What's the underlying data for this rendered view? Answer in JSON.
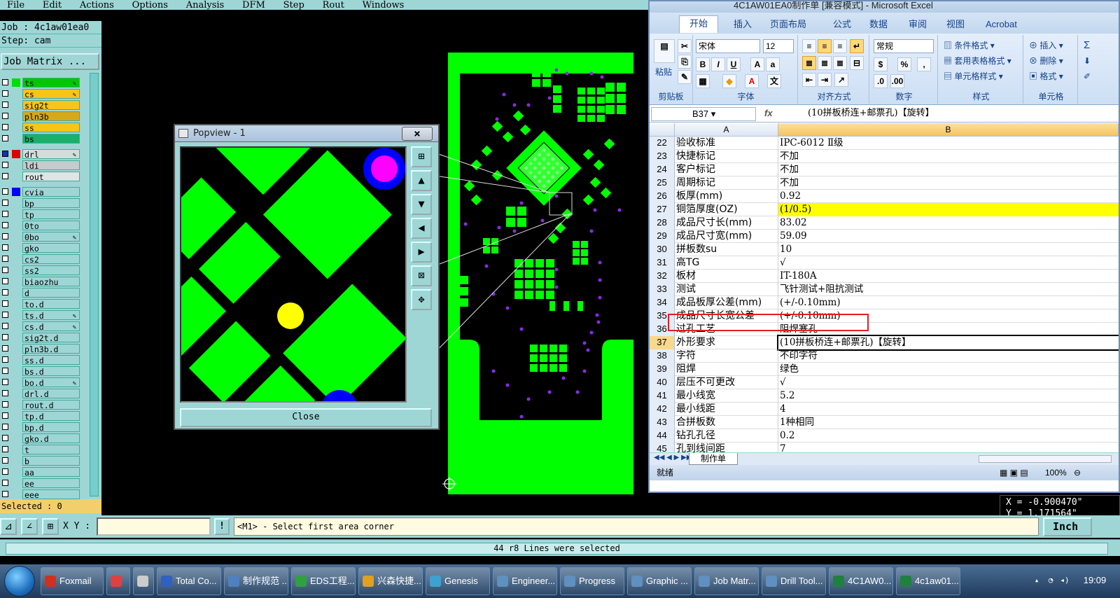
{
  "menu": [
    "File",
    "Edit",
    "Actions",
    "Options",
    "Analysis",
    "DFM",
    "Step",
    "Rout",
    "Windows"
  ],
  "job": {
    "job_label": "Job : 4c1aw01ea0",
    "step_label": "Step: cam",
    "matrix_button": "Job Matrix ..."
  },
  "layers": [
    {
      "name": "ts",
      "color": "#00c800",
      "swatch": "#00e000",
      "edit": true
    },
    {
      "name": "cs",
      "color": "#f5c518",
      "swatch": "",
      "edit": true
    },
    {
      "name": "sig2t",
      "color": "#f5c518",
      "swatch": "",
      "edit": false
    },
    {
      "name": "pln3b",
      "color": "#d7a81a",
      "swatch": "",
      "edit": false
    },
    {
      "name": "ss",
      "color": "#f5c518",
      "swatch": "",
      "edit": false
    },
    {
      "name": "bs",
      "color": "#18b06a",
      "swatch": "",
      "edit": false
    },
    {
      "gap": true
    },
    {
      "name": "drl",
      "color": "#d6dcdc",
      "swatch": "#e00000",
      "edit": true,
      "blue": true
    },
    {
      "name": "ldi",
      "color": "#c4cccc",
      "swatch": "",
      "edit": false
    },
    {
      "name": "rout",
      "color": "#dfe4e4",
      "swatch": "",
      "edit": false
    },
    {
      "gap": true
    },
    {
      "name": "cvia",
      "color": "#9ed6d6",
      "swatch": "#0000ff",
      "edit": false
    },
    {
      "name": "bp",
      "color": "#9ed6d6",
      "swatch": "",
      "edit": false
    },
    {
      "name": "tp",
      "color": "#9ed6d6",
      "swatch": "",
      "edit": false
    },
    {
      "name": "0to",
      "color": "#9ed6d6",
      "swatch": "",
      "edit": false
    },
    {
      "name": "0bo",
      "color": "#9ed6d6",
      "swatch": "",
      "edit": true
    },
    {
      "name": "gko",
      "color": "#9ed6d6",
      "swatch": "",
      "edit": false
    },
    {
      "name": "cs2",
      "color": "#9ed6d6",
      "swatch": "",
      "edit": false
    },
    {
      "name": "ss2",
      "color": "#9ed6d6",
      "swatch": "",
      "edit": false
    },
    {
      "name": "biaozhu",
      "color": "#9ed6d6",
      "swatch": "",
      "edit": false
    },
    {
      "name": "d",
      "color": "#9ed6d6",
      "swatch": "",
      "edit": false
    },
    {
      "name": "to.d",
      "color": "#9ed6d6",
      "swatch": "",
      "edit": false
    },
    {
      "name": "ts.d",
      "color": "#9ed6d6",
      "swatch": "",
      "edit": true
    },
    {
      "name": "cs.d",
      "color": "#9ed6d6",
      "swatch": "",
      "edit": true
    },
    {
      "name": "sig2t.d",
      "color": "#9ed6d6",
      "swatch": "",
      "edit": false
    },
    {
      "name": "pln3b.d",
      "color": "#9ed6d6",
      "swatch": "",
      "edit": false
    },
    {
      "name": "ss.d",
      "color": "#9ed6d6",
      "swatch": "",
      "edit": false
    },
    {
      "name": "bs.d",
      "color": "#9ed6d6",
      "swatch": "",
      "edit": false
    },
    {
      "name": "bo.d",
      "color": "#9ed6d6",
      "swatch": "",
      "edit": true
    },
    {
      "name": "drl.d",
      "color": "#9ed6d6",
      "swatch": "",
      "edit": false
    },
    {
      "name": "rout.d",
      "color": "#9ed6d6",
      "swatch": "",
      "edit": false
    },
    {
      "name": "tp.d",
      "color": "#9ed6d6",
      "swatch": "",
      "edit": false
    },
    {
      "name": "bp.d",
      "color": "#9ed6d6",
      "swatch": "",
      "edit": false
    },
    {
      "name": "gko.d",
      "color": "#9ed6d6",
      "swatch": "",
      "edit": false
    },
    {
      "name": "t",
      "color": "#9ed6d6",
      "swatch": "",
      "edit": false
    },
    {
      "name": "b",
      "color": "#9ed6d6",
      "swatch": "",
      "edit": false
    },
    {
      "name": "aa",
      "color": "#9ed6d6",
      "swatch": "",
      "edit": false
    },
    {
      "name": "ee",
      "color": "#9ed6d6",
      "swatch": "",
      "edit": false
    },
    {
      "name": "eee",
      "color": "#9ed6d6",
      "swatch": "",
      "edit": false
    }
  ],
  "selected_label": "Selected : 0",
  "status": {
    "xy_label": "X Y :",
    "xy_value": "",
    "excl": "!",
    "prompt": "<M1> - Select first area corner",
    "units": "Inch",
    "message": "44 r8 Lines were selected"
  },
  "coords": {
    "x": "X = -0.900470\"",
    "y": "Y = 1.171564\""
  },
  "popview": {
    "title": "Popview - 1",
    "close_x": "×",
    "close_button": "Close"
  },
  "excel": {
    "title": "4C1AW01EA0制作单  [兼容模式] - Microsoft Excel",
    "tabs": [
      "开始",
      "插入",
      "页面布局",
      "公式",
      "数据",
      "审阅",
      "视图",
      "Acrobat"
    ],
    "groups": {
      "clipboard": "剪贴板",
      "font": "字体",
      "align": "对齐方式",
      "number": "数字",
      "style": "样式",
      "cells": "单元格"
    },
    "buttons": {
      "paste": "粘贴",
      "cond_format": "条件格式",
      "table_format": "套用表格格式",
      "cell_style": "单元格样式",
      "insert": "插入",
      "delete": "删除",
      "format": "格式",
      "sum": "Σ"
    },
    "font_name": "宋体",
    "font_size": "12",
    "number_format": "常规",
    "name_box": "B37",
    "fx": "fx",
    "formula": "(10拼板桥连+邮票孔)【旋转】",
    "col_a": "A",
    "col_b": "B",
    "rows": [
      {
        "n": "22",
        "a": "验收标准",
        "b": "IPC-6012 Ⅱ级"
      },
      {
        "n": "23",
        "a": "快捷标记",
        "b": "不加"
      },
      {
        "n": "24",
        "a": "客户标记",
        "b": "不加"
      },
      {
        "n": "25",
        "a": "周期标记",
        "b": "不加"
      },
      {
        "n": "26",
        "a": "板厚(mm)",
        "b": "0.92"
      },
      {
        "n": "27",
        "a": "铜箔厚度(OZ)",
        "b": " (1/0.5)",
        "hl": true
      },
      {
        "n": "28",
        "a": "成品尺寸长(mm)",
        "b": "83.02"
      },
      {
        "n": "29",
        "a": "成品尺寸宽(mm)",
        "b": "59.09"
      },
      {
        "n": "30",
        "a": "拼板数su",
        "b": "10"
      },
      {
        "n": "31",
        "a": "高TG",
        "b": "√"
      },
      {
        "n": "32",
        "a": "板材",
        "b": "IT-180A"
      },
      {
        "n": "33",
        "a": "测试",
        "b": "飞针测试+阻抗测试"
      },
      {
        "n": "34",
        "a": "成品板厚公差(mm)",
        "b": "(+/-0.10mm)"
      },
      {
        "n": "35",
        "a": "成品尺寸长宽公差",
        "b": "(+/-0.10mm)"
      },
      {
        "n": "36",
        "a": "过孔工艺",
        "b": "阻焊塞孔"
      },
      {
        "n": "37",
        "a": "外形要求",
        "b": "(10拼板桥连+邮票孔)【旋转】",
        "sel": true
      },
      {
        "n": "38",
        "a": "字符",
        "b": "不印字符"
      },
      {
        "n": "39",
        "a": "阻焊",
        "b": "绿色"
      },
      {
        "n": "40",
        "a": "层压不可更改",
        "b": "√"
      },
      {
        "n": "41",
        "a": "最小线宽",
        "b": "5.2"
      },
      {
        "n": "42",
        "a": "最小线距",
        "b": "4"
      },
      {
        "n": "43",
        "a": "合拼板数",
        "b": "1种相同"
      },
      {
        "n": "44",
        "a": "钻孔孔径",
        "b": "0.2"
      },
      {
        "n": "45",
        "a": "孔到线间距",
        "b": "7"
      }
    ],
    "sheet_tab": "制作单",
    "status_ready": "就绪",
    "zoom": "100%"
  },
  "taskbar": [
    {
      "label": "Foxmail",
      "color": "#d03020"
    },
    {
      "label": "",
      "color": "#e04040"
    },
    {
      "label": "",
      "color": "#cccccc"
    },
    {
      "label": "Total Co...",
      "color": "#3060c0"
    },
    {
      "label": "制作规范 ...",
      "color": "#5080c0"
    },
    {
      "label": "EDS工程...",
      "color": "#30a040"
    },
    {
      "label": "兴森快捷...",
      "color": "#e0a020"
    },
    {
      "label": "Genesis",
      "color": "#40a0d0"
    },
    {
      "label": "Engineer...",
      "color": "#6090c0"
    },
    {
      "label": "Progress",
      "color": "#6090c0"
    },
    {
      "label": "Graphic ...",
      "color": "#6090c0"
    },
    {
      "label": "Job Matr...",
      "color": "#6090c0"
    },
    {
      "label": "Drill Tool...",
      "color": "#6090c0"
    },
    {
      "label": "4C1AW0...",
      "color": "#1f8040"
    },
    {
      "label": "4c1aw01...",
      "color": "#1f8040"
    }
  ],
  "clock": "19:09"
}
